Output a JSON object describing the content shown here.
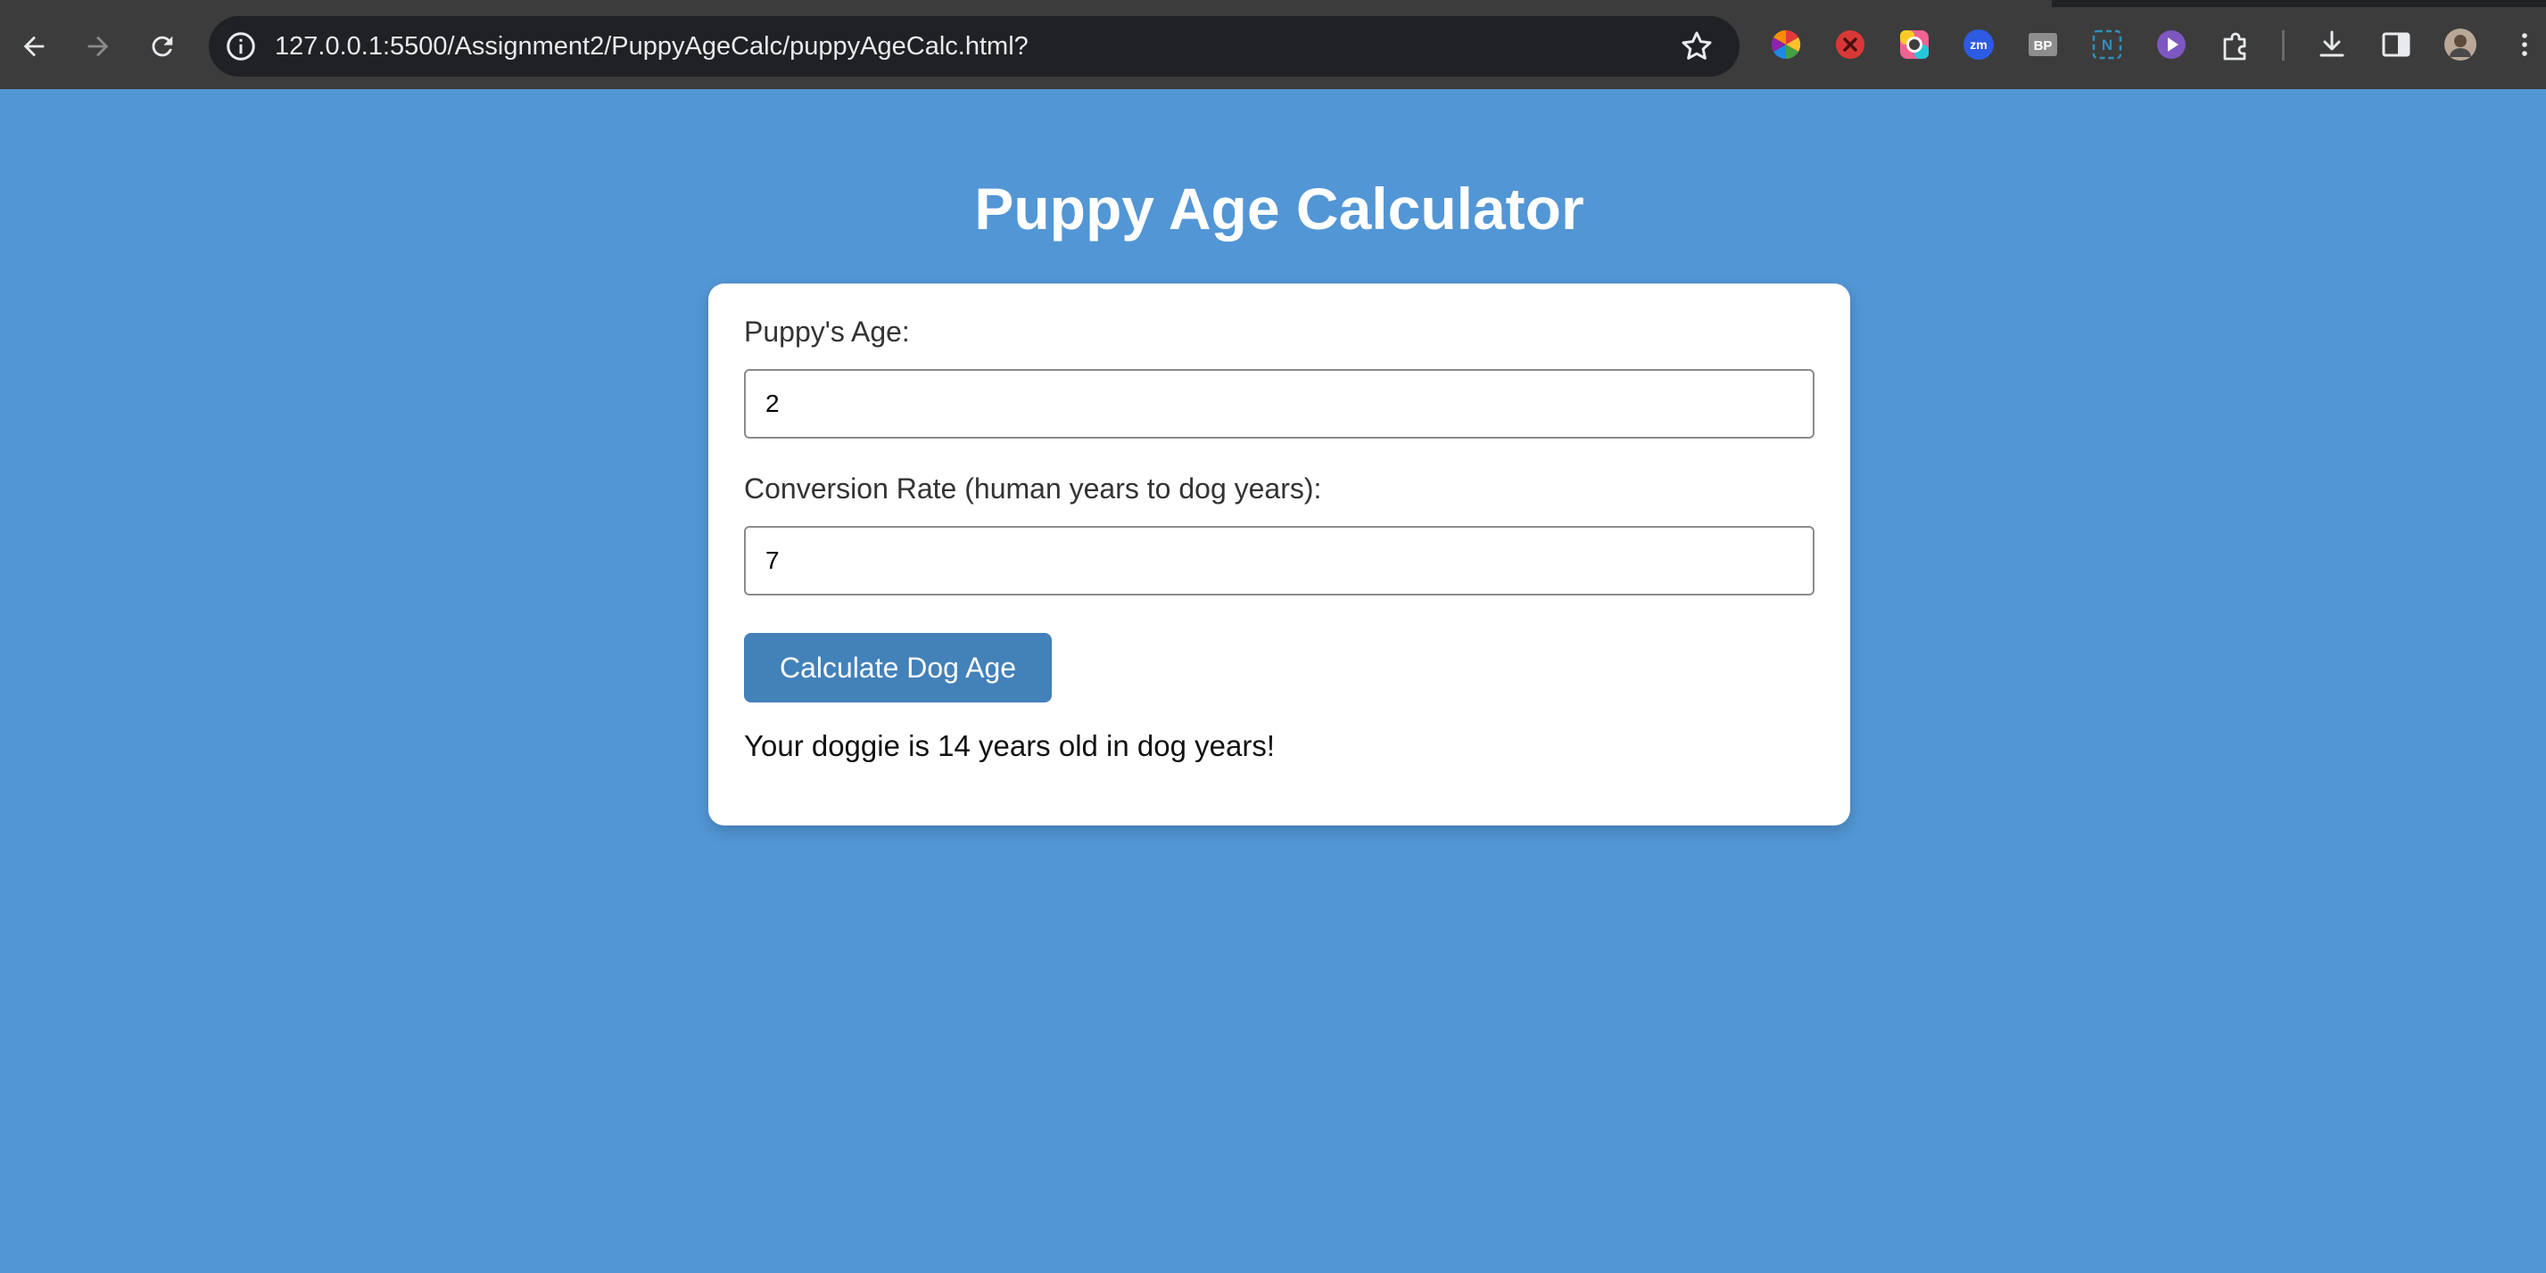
{
  "browser": {
    "url": "127.0.0.1:5500/Assignment2/PuppyAgeCalc/puppyAgeCalc.html?",
    "nav": [
      "back-icon",
      "forward-icon",
      "reload-icon"
    ],
    "extensions": [
      "color-wheel-extension-icon",
      "red-x-extension-icon",
      "rainbow-circle-extension-icon",
      "zoom-extension-icon",
      "bp-extension-icon",
      "n-extension-icon",
      "purple-play-extension-icon",
      "puzzle-extensions-icon"
    ],
    "bp_text": "BP",
    "zm_text": "zm",
    "n_text": "N"
  },
  "page": {
    "title": "Puppy Age Calculator",
    "background": "#5296d5"
  },
  "form": {
    "age_label": "Puppy's Age:",
    "age_value": "2",
    "rate_label": "Conversion Rate (human years to dog years):",
    "rate_value": "7",
    "button_label": "Calculate Dog Age",
    "result": "Your doggie is 14 years old in dog years!",
    "button_color": "#4381b9"
  }
}
